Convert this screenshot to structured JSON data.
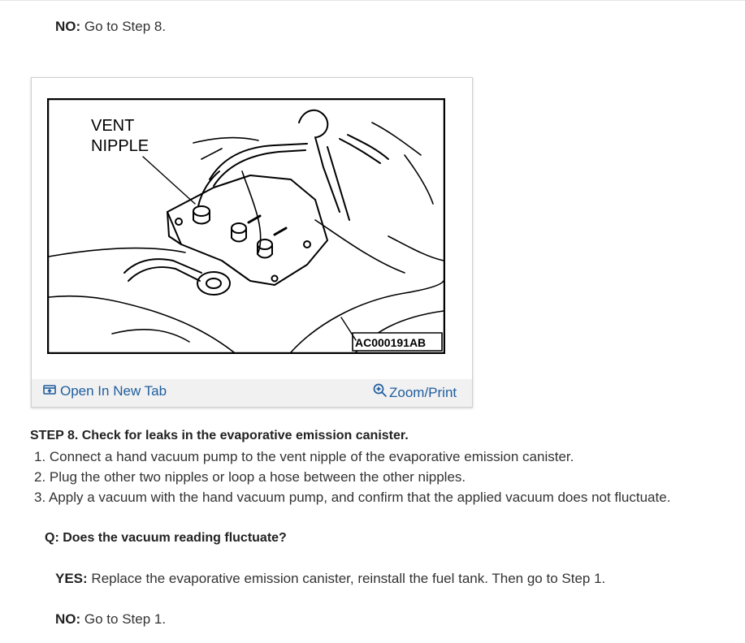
{
  "top_answer": {
    "label": "NO:",
    "text": "Go to Step 8."
  },
  "figure": {
    "vent_label_line1": "VENT",
    "vent_label_line2": "NIPPLE",
    "code": "AC000191AB",
    "open_tab_label": "Open In New Tab",
    "zoom_label": "Zoom/Print",
    "open_tab_icon": "open-in-new-tab-icon",
    "zoom_icon": "zoom-icon",
    "link_color": "#1f5d9e"
  },
  "step": {
    "title": "STEP 8. Check for leaks in the evaporative emission canister.",
    "items": [
      "1. Connect a hand vacuum pump to the vent nipple of the evaporative emission canister.",
      "2. Plug the other two nipples or loop a hose between the other nipples.",
      "3. Apply a vacuum with the hand vacuum pump, and confirm that the applied vacuum does not fluctuate."
    ]
  },
  "question": "Q: Does the vacuum reading fluctuate?",
  "yes_answer": {
    "label": "YES:",
    "text": "Replace the evaporative emission canister, reinstall the fuel tank. Then go to Step 1."
  },
  "no_answer": {
    "label": "NO:",
    "text": "Go to Step 1."
  }
}
